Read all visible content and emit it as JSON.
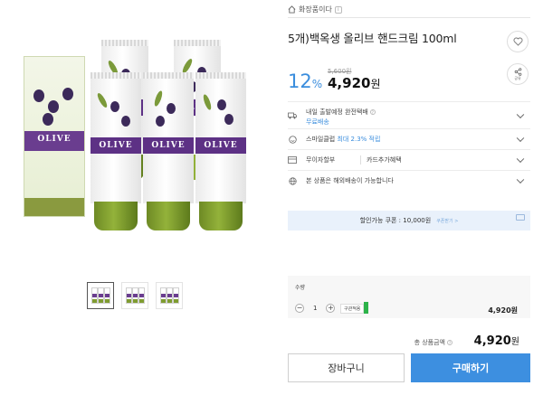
{
  "store": {
    "name": "화장품이다"
  },
  "product": {
    "title": "5개)백옥생 올리브 핸드크림 100ml",
    "discount_rate": "12",
    "discount_unit": "%",
    "original_price": "5,600원",
    "sale_price": "4,920",
    "price_unit": "원",
    "image_box_text": "OLIVE",
    "image_tube_text": "OLIVE"
  },
  "delivery": {
    "line1": "내일 출발예정 완전택배",
    "line2": "무료배송"
  },
  "membership": {
    "prefix": "스마일클럽",
    "highlight": "최대 2.3% 적립"
  },
  "payment": {
    "label": "무이자할부",
    "value": "카드추가혜택"
  },
  "overseas": {
    "text": "본 상품은 해외배송이 가능합니다"
  },
  "coupon": {
    "text": "할인가능 쿠폰 : 10,000원",
    "more": "쿠폰받기 >"
  },
  "quantity": {
    "label": "수량",
    "value": "1",
    "option_tag": "구관적용",
    "line_price": "4,920원"
  },
  "total": {
    "label": "총 상품금액",
    "amount": "4,920",
    "unit": "원"
  },
  "buttons": {
    "cart": "장바구니",
    "buy": "구매하기"
  },
  "colors": {
    "accent": "#3d8fe0",
    "discount": "#3a8ddd",
    "coupon_bg": "#e9f1fb",
    "brand_purple": "#5d3185",
    "cap_green": "#7f9c30"
  },
  "icons": [
    "home-icon",
    "heart-icon",
    "share-icon",
    "truck-icon",
    "smile-icon",
    "card-icon",
    "globe-icon",
    "chevron-down-icon",
    "download-icon"
  ]
}
